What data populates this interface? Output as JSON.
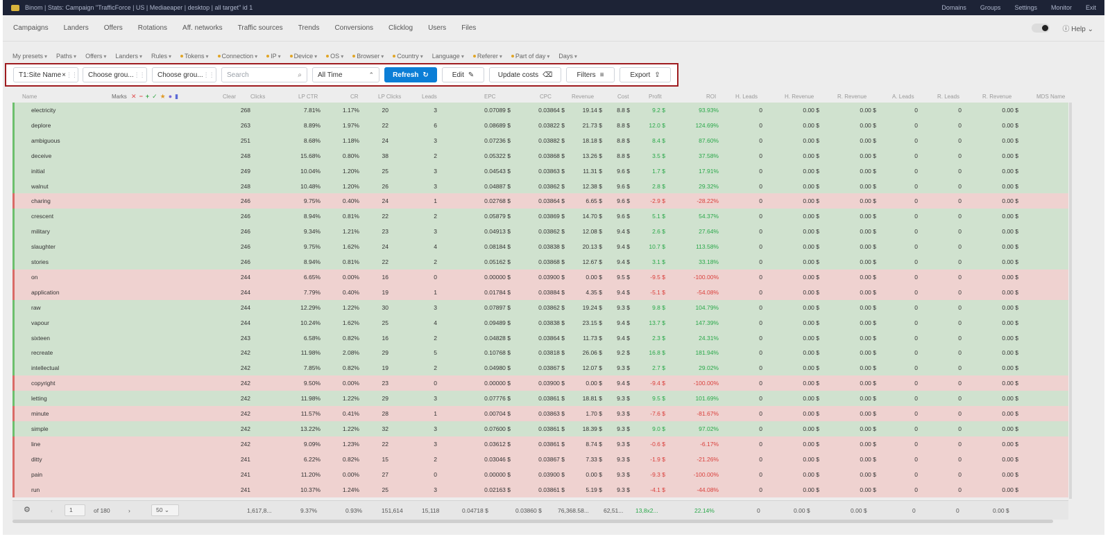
{
  "topbar": {
    "breadcrumb": "Binom  |  Stats: Campaign \"TrafficForce | US | Mediaeaper | desktop | all target\" id 1",
    "links": [
      "Domains",
      "Groups",
      "Settings",
      "Monitor",
      "Exit"
    ],
    "logo_color": "#d9b43c",
    "bg": "#1d2336"
  },
  "nav": {
    "items": [
      "Campaigns",
      "Landers",
      "Offers",
      "Rotations",
      "Aff. networks",
      "Traffic sources",
      "Trends",
      "Conversions",
      "Clicklog",
      "Users",
      "Files"
    ],
    "help": "Help"
  },
  "filter_chips": [
    "My presets",
    "Paths",
    "Offers",
    "Landers",
    "Rules",
    "Tokens",
    "Connection",
    "IP",
    "Device",
    "OS",
    "Browser",
    "Country",
    "Language",
    "Referer",
    "Part of day",
    "Days"
  ],
  "toolbar": {
    "group1": "T1:Site Name",
    "group2": "Choose grou...",
    "group3": "Choose grou...",
    "search_placeholder": "Search",
    "date_range": "All Time",
    "refresh": "Refresh",
    "edit": "Edit",
    "update_costs": "Update costs",
    "filters": "Filters",
    "export": "Export",
    "primary_color": "#0b7ed6",
    "highlight_color": "#9e1b1f"
  },
  "table": {
    "headers": [
      "Name",
      "Marks",
      "Clear",
      "Clicks",
      "LP CTR",
      "CR",
      "LP Clicks",
      "Leads",
      "EPC",
      "CPC",
      "Revenue",
      "Cost",
      "Profit",
      "ROI",
      "H. Leads",
      "H. Revenue",
      "R. Revenue",
      "A. Leads",
      "R. Leads",
      "R. Revenue",
      "MDS Name"
    ],
    "rows": [
      {
        "name": "electricity",
        "clicks": "268",
        "lpctr": "7.81%",
        "cr": "1.17%",
        "lpclicks": "20",
        "leads": "3",
        "epc": "0.07089 $",
        "cpc": "0.03864 $",
        "revenue": "19.14 $",
        "cost": "8.8 $",
        "profit": "9.2 $",
        "roi": "93.93%",
        "status": "pos"
      },
      {
        "name": "deplore",
        "clicks": "263",
        "lpctr": "8.89%",
        "cr": "1.97%",
        "lpclicks": "22",
        "leads": "6",
        "epc": "0.08689 $",
        "cpc": "0.03822 $",
        "revenue": "21.73 $",
        "cost": "8.8 $",
        "profit": "12.0 $",
        "roi": "124.69%",
        "status": "pos"
      },
      {
        "name": "ambiguous",
        "clicks": "251",
        "lpctr": "8.68%",
        "cr": "1.18%",
        "lpclicks": "24",
        "leads": "3",
        "epc": "0.07236 $",
        "cpc": "0.03882 $",
        "revenue": "18.18 $",
        "cost": "8.8 $",
        "profit": "8.4 $",
        "roi": "87.60%",
        "status": "pos"
      },
      {
        "name": "deceive",
        "clicks": "248",
        "lpctr": "15.68%",
        "cr": "0.80%",
        "lpclicks": "38",
        "leads": "2",
        "epc": "0.05322 $",
        "cpc": "0.03868 $",
        "revenue": "13.26 $",
        "cost": "8.8 $",
        "profit": "3.5 $",
        "roi": "37.58%",
        "status": "pos"
      },
      {
        "name": "initial",
        "clicks": "249",
        "lpctr": "10.04%",
        "cr": "1.20%",
        "lpclicks": "25",
        "leads": "3",
        "epc": "0.04543 $",
        "cpc": "0.03863 $",
        "revenue": "11.31 $",
        "cost": "9.6 $",
        "profit": "1.7 $",
        "roi": "17.91%",
        "status": "pos"
      },
      {
        "name": "walnut",
        "clicks": "248",
        "lpctr": "10.48%",
        "cr": "1.20%",
        "lpclicks": "26",
        "leads": "3",
        "epc": "0.04887 $",
        "cpc": "0.03862 $",
        "revenue": "12.38 $",
        "cost": "9.6 $",
        "profit": "2.8 $",
        "roi": "29.32%",
        "status": "pos"
      },
      {
        "name": "charing",
        "clicks": "246",
        "lpctr": "9.75%",
        "cr": "0.40%",
        "lpclicks": "24",
        "leads": "1",
        "epc": "0.02768 $",
        "cpc": "0.03864 $",
        "revenue": "6.65 $",
        "cost": "9.6 $",
        "profit": "-2.9 $",
        "roi": "-28.22%",
        "status": "neg"
      },
      {
        "name": "crescent",
        "clicks": "246",
        "lpctr": "8.94%",
        "cr": "0.81%",
        "lpclicks": "22",
        "leads": "2",
        "epc": "0.05879 $",
        "cpc": "0.03869 $",
        "revenue": "14.70 $",
        "cost": "9.6 $",
        "profit": "5.1 $",
        "roi": "54.37%",
        "status": "pos"
      },
      {
        "name": "military",
        "clicks": "246",
        "lpctr": "9.34%",
        "cr": "1.21%",
        "lpclicks": "23",
        "leads": "3",
        "epc": "0.04913 $",
        "cpc": "0.03862 $",
        "revenue": "12.08 $",
        "cost": "9.4 $",
        "profit": "2.6 $",
        "roi": "27.64%",
        "status": "pos"
      },
      {
        "name": "slaughter",
        "clicks": "246",
        "lpctr": "9.75%",
        "cr": "1.62%",
        "lpclicks": "24",
        "leads": "4",
        "epc": "0.08184 $",
        "cpc": "0.03838 $",
        "revenue": "20.13 $",
        "cost": "9.4 $",
        "profit": "10.7 $",
        "roi": "113.58%",
        "status": "pos"
      },
      {
        "name": "stories",
        "clicks": "246",
        "lpctr": "8.94%",
        "cr": "0.81%",
        "lpclicks": "22",
        "leads": "2",
        "epc": "0.05162 $",
        "cpc": "0.03868 $",
        "revenue": "12.67 $",
        "cost": "9.4 $",
        "profit": "3.1 $",
        "roi": "33.18%",
        "status": "pos"
      },
      {
        "name": "on",
        "clicks": "244",
        "lpctr": "6.65%",
        "cr": "0.00%",
        "lpclicks": "16",
        "leads": "0",
        "epc": "0.00000 $",
        "cpc": "0.03900 $",
        "revenue": "0.00 $",
        "cost": "9.5 $",
        "profit": "-9.5 $",
        "roi": "-100.00%",
        "status": "neg"
      },
      {
        "name": "application",
        "clicks": "244",
        "lpctr": "7.79%",
        "cr": "0.40%",
        "lpclicks": "19",
        "leads": "1",
        "epc": "0.01784 $",
        "cpc": "0.03884 $",
        "revenue": "4.35 $",
        "cost": "9.4 $",
        "profit": "-5.1 $",
        "roi": "-54.08%",
        "status": "neg"
      },
      {
        "name": "raw",
        "clicks": "244",
        "lpctr": "12.29%",
        "cr": "1.22%",
        "lpclicks": "30",
        "leads": "3",
        "epc": "0.07897 $",
        "cpc": "0.03862 $",
        "revenue": "19.24 $",
        "cost": "9.3 $",
        "profit": "9.8 $",
        "roi": "104.79%",
        "status": "pos"
      },
      {
        "name": "vapour",
        "clicks": "244",
        "lpctr": "10.24%",
        "cr": "1.62%",
        "lpclicks": "25",
        "leads": "4",
        "epc": "0.09489 $",
        "cpc": "0.03838 $",
        "revenue": "23.15 $",
        "cost": "9.4 $",
        "profit": "13.7 $",
        "roi": "147.39%",
        "status": "pos"
      },
      {
        "name": "sixteen",
        "clicks": "243",
        "lpctr": "6.58%",
        "cr": "0.82%",
        "lpclicks": "16",
        "leads": "2",
        "epc": "0.04828 $",
        "cpc": "0.03864 $",
        "revenue": "11.73 $",
        "cost": "9.4 $",
        "profit": "2.3 $",
        "roi": "24.31%",
        "status": "pos"
      },
      {
        "name": "recreate",
        "clicks": "242",
        "lpctr": "11.98%",
        "cr": "2.08%",
        "lpclicks": "29",
        "leads": "5",
        "epc": "0.10768 $",
        "cpc": "0.03818 $",
        "revenue": "26.06 $",
        "cost": "9.2 $",
        "profit": "16.8 $",
        "roi": "181.94%",
        "status": "pos"
      },
      {
        "name": "intellectual",
        "clicks": "242",
        "lpctr": "7.85%",
        "cr": "0.82%",
        "lpclicks": "19",
        "leads": "2",
        "epc": "0.04980 $",
        "cpc": "0.03867 $",
        "revenue": "12.07 $",
        "cost": "9.3 $",
        "profit": "2.7 $",
        "roi": "29.02%",
        "status": "pos"
      },
      {
        "name": "copyright",
        "clicks": "242",
        "lpctr": "9.50%",
        "cr": "0.00%",
        "lpclicks": "23",
        "leads": "0",
        "epc": "0.00000 $",
        "cpc": "0.03900 $",
        "revenue": "0.00 $",
        "cost": "9.4 $",
        "profit": "-9.4 $",
        "roi": "-100.00%",
        "status": "neg"
      },
      {
        "name": "letting",
        "clicks": "242",
        "lpctr": "11.98%",
        "cr": "1.22%",
        "lpclicks": "29",
        "leads": "3",
        "epc": "0.07776 $",
        "cpc": "0.03861 $",
        "revenue": "18.81 $",
        "cost": "9.3 $",
        "profit": "9.5 $",
        "roi": "101.69%",
        "status": "pos"
      },
      {
        "name": "minute",
        "clicks": "242",
        "lpctr": "11.57%",
        "cr": "0.41%",
        "lpclicks": "28",
        "leads": "1",
        "epc": "0.00704 $",
        "cpc": "0.03863 $",
        "revenue": "1.70 $",
        "cost": "9.3 $",
        "profit": "-7.6 $",
        "roi": "-81.67%",
        "status": "neg"
      },
      {
        "name": "simple",
        "clicks": "242",
        "lpctr": "13.22%",
        "cr": "1.22%",
        "lpclicks": "32",
        "leads": "3",
        "epc": "0.07600 $",
        "cpc": "0.03861 $",
        "revenue": "18.39 $",
        "cost": "9.3 $",
        "profit": "9.0 $",
        "roi": "97.02%",
        "status": "pos"
      },
      {
        "name": "line",
        "clicks": "242",
        "lpctr": "9.09%",
        "cr": "1.23%",
        "lpclicks": "22",
        "leads": "3",
        "epc": "0.03612 $",
        "cpc": "0.03861 $",
        "revenue": "8.74 $",
        "cost": "9.3 $",
        "profit": "-0.6 $",
        "roi": "-6.17%",
        "status": "neg"
      },
      {
        "name": "ditty",
        "clicks": "241",
        "lpctr": "6.22%",
        "cr": "0.82%",
        "lpclicks": "15",
        "leads": "2",
        "epc": "0.03046 $",
        "cpc": "0.03867 $",
        "revenue": "7.33 $",
        "cost": "9.3 $",
        "profit": "-1.9 $",
        "roi": "-21.26%",
        "status": "neg"
      },
      {
        "name": "pain",
        "clicks": "241",
        "lpctr": "11.20%",
        "cr": "0.00%",
        "lpclicks": "27",
        "leads": "0",
        "epc": "0.00000 $",
        "cpc": "0.03900 $",
        "revenue": "0.00 $",
        "cost": "9.3 $",
        "profit": "-9.3 $",
        "roi": "-100.00%",
        "status": "neg"
      },
      {
        "name": "run",
        "clicks": "241",
        "lpctr": "10.37%",
        "cr": "1.24%",
        "lpclicks": "25",
        "leads": "3",
        "epc": "0.02163 $",
        "cpc": "0.03861 $",
        "revenue": "5.19 $",
        "cost": "9.3 $",
        "profit": "-4.1 $",
        "roi": "-44.08%",
        "status": "neg"
      }
    ],
    "extra_cols": {
      "hleads": "0",
      "hrev": "0.00 $",
      "rrev": "0.00 $",
      "aleads": "0",
      "rleads": "0",
      "rrev2": "0.00 $"
    }
  },
  "footer": {
    "page": "1",
    "of_pages": "of 180",
    "per_page": "50",
    "total_clicks": "1,617,8...",
    "total_lpctr": "9.37%",
    "total_cr": "0.93%",
    "total_lpclicks": "151,614",
    "total_leads": "15,118",
    "total_epc": "0.04718 $",
    "total_cpc": "0.03860 $",
    "total_revenue": "76,368.58...",
    "total_cost": "62,51...",
    "total_profit": "13,8x2...",
    "total_roi": "22.14%",
    "zero": "0",
    "zero_money": "0.00 $"
  }
}
